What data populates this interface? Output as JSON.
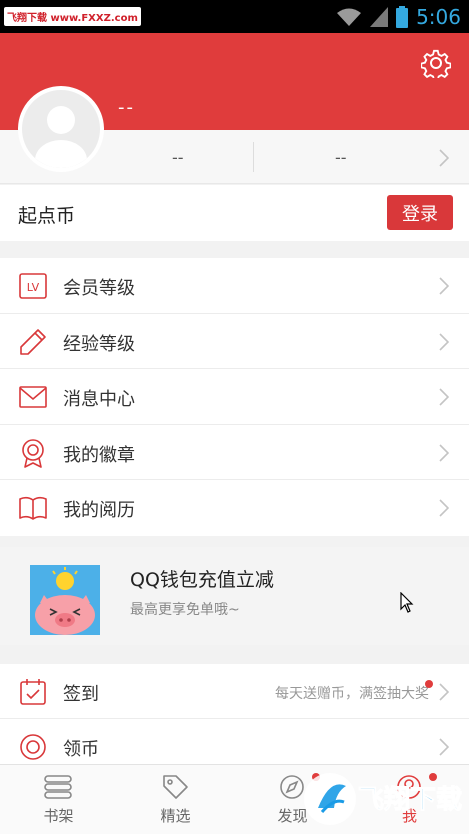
{
  "status_bar": {
    "watermark": "飞翔下载 www.FXXZ.com",
    "time": "5:06"
  },
  "profile": {
    "nickname": "--",
    "stat_1": "--",
    "stat_2": "--"
  },
  "coins": {
    "label": "起点币",
    "login_button": "登录"
  },
  "menu": {
    "items": [
      {
        "label": "会员等级",
        "icon": "lv-icon"
      },
      {
        "label": "经验等级",
        "icon": "pencil-icon"
      },
      {
        "label": "消息中心",
        "icon": "mail-icon"
      },
      {
        "label": "我的徽章",
        "icon": "badge-icon"
      },
      {
        "label": "我的阅历",
        "icon": "book-icon"
      }
    ]
  },
  "banner": {
    "title": "QQ钱包充值立减",
    "subtitle": "最高更享免单哦~"
  },
  "tasks": {
    "items": [
      {
        "label": "签到",
        "desc": "每天送赠币，满签抽大奖",
        "icon": "calendar-check-icon"
      },
      {
        "label": "领币",
        "desc": "",
        "icon": "coin-icon"
      }
    ]
  },
  "tabbar": {
    "tabs": [
      {
        "label": "书架",
        "icon": "bookshelf-icon"
      },
      {
        "label": "精选",
        "icon": "tag-icon"
      },
      {
        "label": "发现",
        "icon": "compass-icon"
      },
      {
        "label": "我",
        "icon": "person-icon"
      }
    ]
  },
  "logo_watermark": "飞翔下载",
  "colors": {
    "brand_red": "#e03c3c",
    "button_red": "#d9383a",
    "status_time": "#34a9e0"
  }
}
